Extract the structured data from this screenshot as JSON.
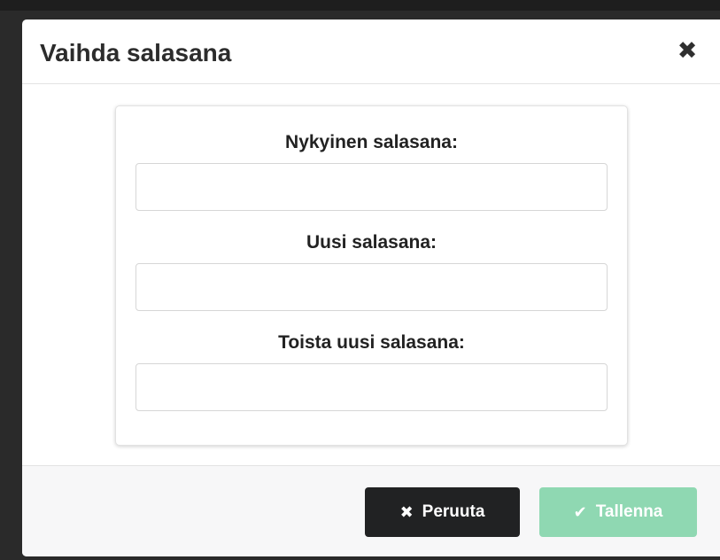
{
  "modal": {
    "title": "Vaihda salasana",
    "close_icon": "close-icon"
  },
  "form": {
    "fields": [
      {
        "label": "Nykyinen salasana:",
        "value": "",
        "placeholder": ""
      },
      {
        "label": "Uusi salasana:",
        "value": "",
        "placeholder": ""
      },
      {
        "label": "Toista uusi salasana:",
        "value": "",
        "placeholder": ""
      }
    ]
  },
  "footer": {
    "cancel_label": "Peruuta",
    "cancel_icon": "times-icon",
    "save_label": "Tallenna",
    "save_icon": "check-icon"
  },
  "colors": {
    "cancel_button": "#212223",
    "save_button": "#8fd8b2",
    "footer_background": "#f7f7f8"
  }
}
